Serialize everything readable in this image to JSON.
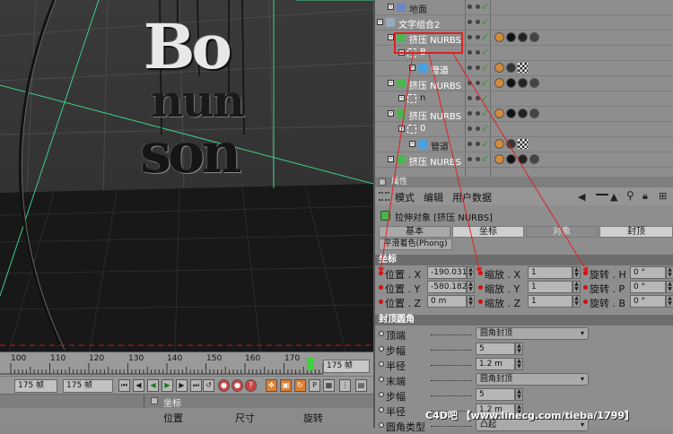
{
  "viewport": {
    "logo_text": [
      "Bo",
      "nun",
      "son"
    ]
  },
  "timeline": {
    "ticks": [
      "100",
      "110",
      "120",
      "130",
      "140",
      "150",
      "160",
      "170"
    ],
    "end_field": "175 帧"
  },
  "transport": {
    "left_field": "175 帧",
    "current_field": "175 帧"
  },
  "coordinates": {
    "title": "坐标",
    "col_position": "位置",
    "col_size": "尺寸",
    "col_rotation": "旋转"
  },
  "object_manager": {
    "rows": [
      {
        "name": "地面",
        "indent": 1,
        "light": false
      },
      {
        "name": "文字组合2",
        "indent": 0,
        "light": true
      },
      {
        "name": "挤压 NURBS",
        "indent": 1,
        "light": true
      },
      {
        "name": "B",
        "indent": 2,
        "light": true
      },
      {
        "name": "管道",
        "indent": 3,
        "light": true
      },
      {
        "name": "挤压 NURBS",
        "indent": 1,
        "light": true
      },
      {
        "name": "n",
        "indent": 2,
        "light": false
      },
      {
        "name": "挤压 NURBS",
        "indent": 1,
        "light": true
      },
      {
        "name": "0",
        "indent": 2,
        "light": true
      },
      {
        "name": "管道",
        "indent": 3,
        "light": false
      },
      {
        "name": "挤压 NURBS",
        "indent": 1,
        "light": true
      }
    ]
  },
  "attributes": {
    "panel_title": "属性",
    "menu": [
      "模式",
      "编辑",
      "用户数据"
    ],
    "object_title": "拉伸对象 [挤压 NURBS]",
    "tabs_row1": [
      "基本",
      "坐标",
      "对象",
      "封顶"
    ],
    "tabs_row2": [
      "平滑着色(Phong)"
    ],
    "section_coord": "坐标",
    "pos_rows": [
      {
        "pos_label": "位置 . X",
        "pos_val": "-190.031",
        "scale_label": "缩放 . X",
        "scale_val": "1",
        "rot_label": "旋转 . H",
        "rot_val": "0 °"
      },
      {
        "pos_label": "位置 . Y",
        "pos_val": "-580.182",
        "scale_label": "缩放 . Y",
        "scale_val": "1",
        "rot_label": "旋转 . P",
        "rot_val": "0 °"
      },
      {
        "pos_label": "位置 . Z",
        "pos_val": "0 m",
        "scale_label": "缩放 . Z",
        "scale_val": "1",
        "rot_label": "旋转 . B",
        "rot_val": "0 °"
      }
    ],
    "section_cap": "封顶圆角",
    "cap_rows": [
      {
        "label": "顶端",
        "value": "圆角封顶",
        "kind": "drop"
      },
      {
        "label": "步幅",
        "value": "5",
        "kind": "field"
      },
      {
        "label": "半径",
        "value": "1.2 m",
        "kind": "field"
      },
      {
        "label": "末端",
        "value": "圆角封顶",
        "kind": "drop"
      },
      {
        "label": "步幅",
        "value": "5",
        "kind": "field"
      },
      {
        "label": "半径",
        "value": "1.2 m",
        "kind": "field"
      },
      {
        "label": "圆角类型",
        "value": "凸起",
        "kind": "drop"
      }
    ]
  },
  "watermark": "C4D吧 【www.linecg.com/tieba/1799】",
  "colors": {
    "annotation_red": "#e02020",
    "grid_line": "#3fd08a"
  }
}
